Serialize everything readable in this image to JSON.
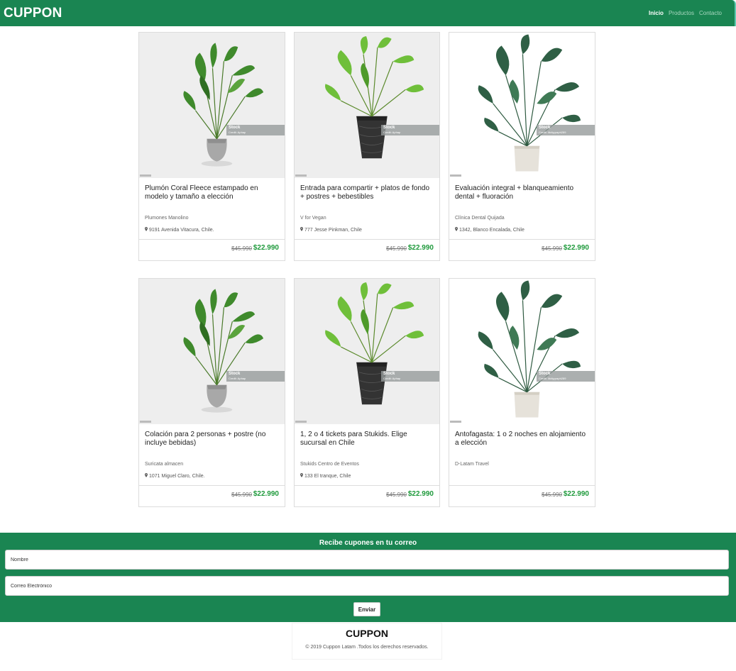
{
  "header": {
    "brand": "CUPPON",
    "nav": [
      "Inicio",
      "Productos",
      "Contacto"
    ]
  },
  "cards": [
    {
      "title": "Plumón Coral Fleece estampado en modelo y tamaño a elección",
      "vendor": "Plumones Manolino",
      "address": "9191 Avenida Vitacura, Chile.",
      "price_old": "$45.990",
      "price_new": "$22.990",
      "stock": "Stock",
      "credit": "Credit: Aphap",
      "plant": "palm-concrete-pot"
    },
    {
      "title": "Entrada para compartir + platos de fondo + postres + bebestibles",
      "vendor": "V for Vegan",
      "address": "777 Jesse Pinkman, Chile",
      "price_old": "$45.990",
      "price_new": "$22.990",
      "stock": "Stock",
      "credit": "Credit: Aphap",
      "plant": "palm-black-pot"
    },
    {
      "title": "Evaluación integral + blanqueamiento dental + fluoración",
      "vendor": "Clínica Dental Quijada",
      "address": "1342, Blanco Encalada, Chile",
      "price_old": "$45.990",
      "price_new": "$22.990",
      "stock": "Stock",
      "credit": "Credit: illcitygraph289",
      "plant": "bird-of-paradise"
    },
    {
      "title": "Colación para 2 personas + postre (no incluye bebidas)",
      "vendor": "Suricata almacen",
      "address": "1071 Miguel Claro, Chile.",
      "price_old": "$45.990",
      "price_new": "$22.990",
      "stock": "Stock",
      "credit": "Credit: Aphap",
      "plant": "palm-concrete-pot"
    },
    {
      "title": "1, 2 o 4 tickets para Stukids. Elige sucursal en Chile",
      "vendor": "Stukids Centro de Eventos",
      "address": "133 El tranque, Chile",
      "price_old": "$45.990",
      "price_new": "$22.990",
      "stock": "Stock",
      "credit": "Credit: Aphap",
      "plant": "palm-black-pot"
    },
    {
      "title": "Antofagasta: 1 o 2 noches en alojamiento a elección",
      "vendor": "D-Latam Travel",
      "address": "",
      "price_old": "$45.990",
      "price_new": "$22.990",
      "stock": "Stock",
      "credit": "Credit: illcitygraph289",
      "plant": "bird-of-paradise"
    }
  ],
  "subscribe": {
    "title": "Recibe cupones en tu correo",
    "name_placeholder": "Nombre",
    "email_placeholder": "Correo Electrónico",
    "button": "Enviar"
  },
  "footer": {
    "brand": "CUPPON",
    "copyright": "© 2019 Cuppon Latam .Todos los derechos reservados."
  },
  "colors": {
    "brand_green": "#1a8552",
    "price_green": "#1f9a3c"
  }
}
